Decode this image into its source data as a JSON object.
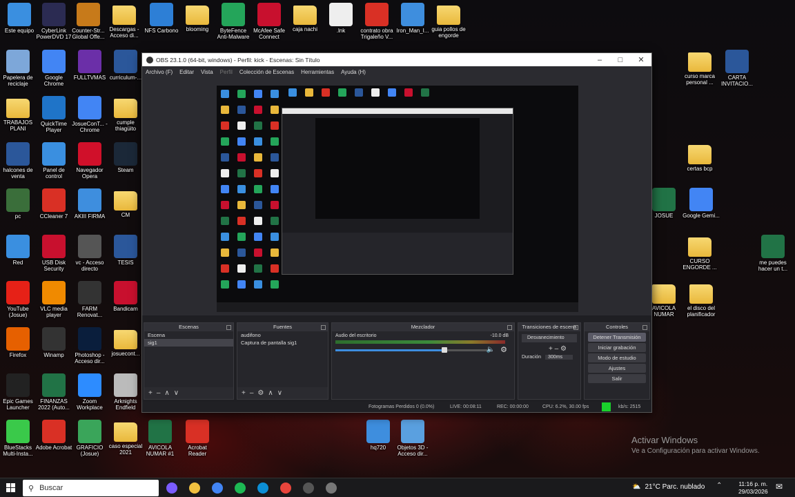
{
  "desktop": {
    "icons_left": [
      {
        "label": "Este equipo",
        "color": "#3a8fe0"
      },
      {
        "label": "CyberLink PowerDVD 17",
        "color": "#2b2b52"
      },
      {
        "label": "Counter-Str... Global Offe...",
        "color": "#c77a1a"
      },
      {
        "label": "Descargas - Acceso di...",
        "color": "folder"
      },
      {
        "label": "NFS Carbono",
        "color": "#2d7fd6"
      },
      {
        "label": "blooming",
        "color": "folder"
      },
      {
        "label": "ByteFence Anti-Malware",
        "color": "#24a55a"
      },
      {
        "label": "McAfee Safe Connect",
        "color": "#c8102e"
      },
      {
        "label": "caja nachi",
        "color": "folder"
      },
      {
        "label": ".lnk",
        "color": "#eeeeee"
      },
      {
        "label": "contrato obra Trigaleño V...",
        "color": "#d93025"
      },
      {
        "label": "Iron_Man_I...",
        "color": "#3e8ede"
      },
      {
        "label": "guia pollos de engorde",
        "color": "folder"
      }
    ],
    "col1": [
      {
        "label": "Papelera de reciclaje",
        "color": "#7da7d9"
      },
      {
        "label": "TRABAJOS PLANI",
        "color": "folder"
      },
      {
        "label": "halcones de venta",
        "color": "#2b579a"
      },
      {
        "label": "pc",
        "color": "#3a6e3a"
      },
      {
        "label": "Red",
        "color": "#3a8fe0"
      },
      {
        "label": "YouTube (Josue)",
        "color": "#e62117"
      },
      {
        "label": "Firefox",
        "color": "#e66000"
      },
      {
        "label": "Epic Games Launcher",
        "color": "#222222"
      },
      {
        "label": "BlueStacks Multi-Insta...",
        "color": "#3ac94a"
      }
    ],
    "col2": [
      {
        "label": "Google Chrome",
        "color": "#4285f4"
      },
      {
        "label": "QuickTime Player",
        "color": "#1f74c8"
      },
      {
        "label": "Panel de control",
        "color": "#3a8fe0"
      },
      {
        "label": "CCleaner 7",
        "color": "#d93025"
      },
      {
        "label": "USB Disk Security",
        "color": "#c8102e"
      },
      {
        "label": "VLC media player",
        "color": "#f08a00"
      },
      {
        "label": "Winamp",
        "color": "#333333"
      },
      {
        "label": "FINANZAS 2022 (Auto...",
        "color": "#217346"
      },
      {
        "label": "Adobe Acrobat",
        "color": "#d93025"
      }
    ],
    "col3": [
      {
        "label": "FULLTVMAS",
        "color": "#6b2fa8"
      },
      {
        "label": "JosueConT... - Chrome",
        "color": "#4285f4"
      },
      {
        "label": "Navegador Opera",
        "color": "#d0102a"
      },
      {
        "label": "AKIII FIRMA",
        "color": "#3e8ede"
      },
      {
        "label": "vc - Acceso directo",
        "color": "#555555"
      },
      {
        "label": "FARM Renovat...",
        "color": "#333333"
      },
      {
        "label": "Photoshop - Acceso dir...",
        "color": "#0a1e3c"
      },
      {
        "label": "Zoom Workplace",
        "color": "#2d8cff"
      },
      {
        "label": "GRAFICIO (Josue)",
        "color": "#3aa55a"
      }
    ],
    "col4": [
      {
        "label": "curriculum-...",
        "color": "#2b579a"
      },
      {
        "label": "cumple thiagüito",
        "color": "folder"
      },
      {
        "label": "Steam",
        "color": "#1b2838"
      },
      {
        "label": "CM",
        "color": "folder"
      },
      {
        "label": "TESIS",
        "color": "#2b579a"
      },
      {
        "label": "Bandicam",
        "color": "#c8102e"
      },
      {
        "label": "josuecont...",
        "color": "folder"
      },
      {
        "label": "Arknights Endfield",
        "color": "#bbbbbb"
      },
      {
        "label": "caso especial 2021",
        "color": "folder"
      }
    ],
    "bottom_icons": [
      {
        "label": "AVICOLA NUMAR #1",
        "color": "#217346"
      },
      {
        "label": "Acrobat Reader",
        "color": "#d93025"
      },
      {
        "label": "hq720",
        "color": "#3e8ede"
      },
      {
        "label": "Objetos 3D - Acceso dir...",
        "color": "#5aa0e0"
      }
    ],
    "right_icons": [
      {
        "label": "curso marca personal ...",
        "color": "folder"
      },
      {
        "label": "CARTA INVITACIO...",
        "color": "#2b579a"
      },
      {
        "label": "certas bcp",
        "color": "folder"
      },
      {
        "label": "JOSUE",
        "color": "#217346"
      },
      {
        "label": "Google Gemi...",
        "color": "#4285f4"
      },
      {
        "label": "CURSO ENGORDE ...",
        "color": "folder"
      },
      {
        "label": "me puedes hacer un t...",
        "color": "#217346"
      },
      {
        "label": "AVICOLA NUMAR",
        "color": "folder"
      },
      {
        "label": "el disco del planificador",
        "color": "folder"
      }
    ],
    "activate_title": "Activar Windows",
    "activate_sub": "Ve a Configuración para activar Windows."
  },
  "obs": {
    "title": "OBS 23.1.0 (64-bit, windows) - Perfil: kick - Escenas: Sin Título",
    "menu": [
      "Archivo (F)",
      "Editar",
      "Vista",
      "Perfil",
      "Colección de Escenas",
      "Herramientas",
      "Ayuda (H)"
    ],
    "scenes_title": "Escenas",
    "scenes": [
      "Escena",
      "sig1"
    ],
    "sources_title": "Fuentes",
    "sources": [
      "audifono",
      "Captura de pantalla sig1"
    ],
    "mixer_title": "Mezclador",
    "mixer_channel": "Audio del escritorio",
    "mixer_db": "-10.0 dB",
    "mixer_level": 0.72,
    "transitions_title": "Transiciones de escena",
    "transition": "Desvanecimiento",
    "duration_label": "Duración",
    "duration_value": "300ms",
    "controls_title": "Controles",
    "controls": [
      "Detener Transmisión",
      "Iniciar grabación",
      "Modo de estudio",
      "Ajustes",
      "Salir"
    ],
    "status": {
      "dropped": "Fotogramas Perdidos 0 (0.0%)",
      "live": "LIVE: 00:08:11",
      "rec": "REC: 00:00:00",
      "cpu": "CPU: 6.2%, 30.00 fps",
      "kbps": "kb/s: 2515"
    },
    "live_color": "#19d12c"
  },
  "taskbar": {
    "search_placeholder": "Buscar",
    "weather": "21°C  Parc. nublado",
    "time": "11:16 p. m.",
    "date": "29/03/2026",
    "apps": [
      {
        "name": "copilot-icon",
        "color": "#7a5cff"
      },
      {
        "name": "file-explorer-icon",
        "color": "#f0c040"
      },
      {
        "name": "chrome-icon",
        "color": "#4285f4"
      },
      {
        "name": "spotify-icon",
        "color": "#1db954"
      },
      {
        "name": "edge-icon",
        "color": "#0c8fd6"
      },
      {
        "name": "chrome-profile-icon",
        "color": "#e8453c"
      },
      {
        "name": "obs-icon",
        "color": "#555555"
      },
      {
        "name": "terminal-icon",
        "color": "#777777"
      }
    ]
  }
}
